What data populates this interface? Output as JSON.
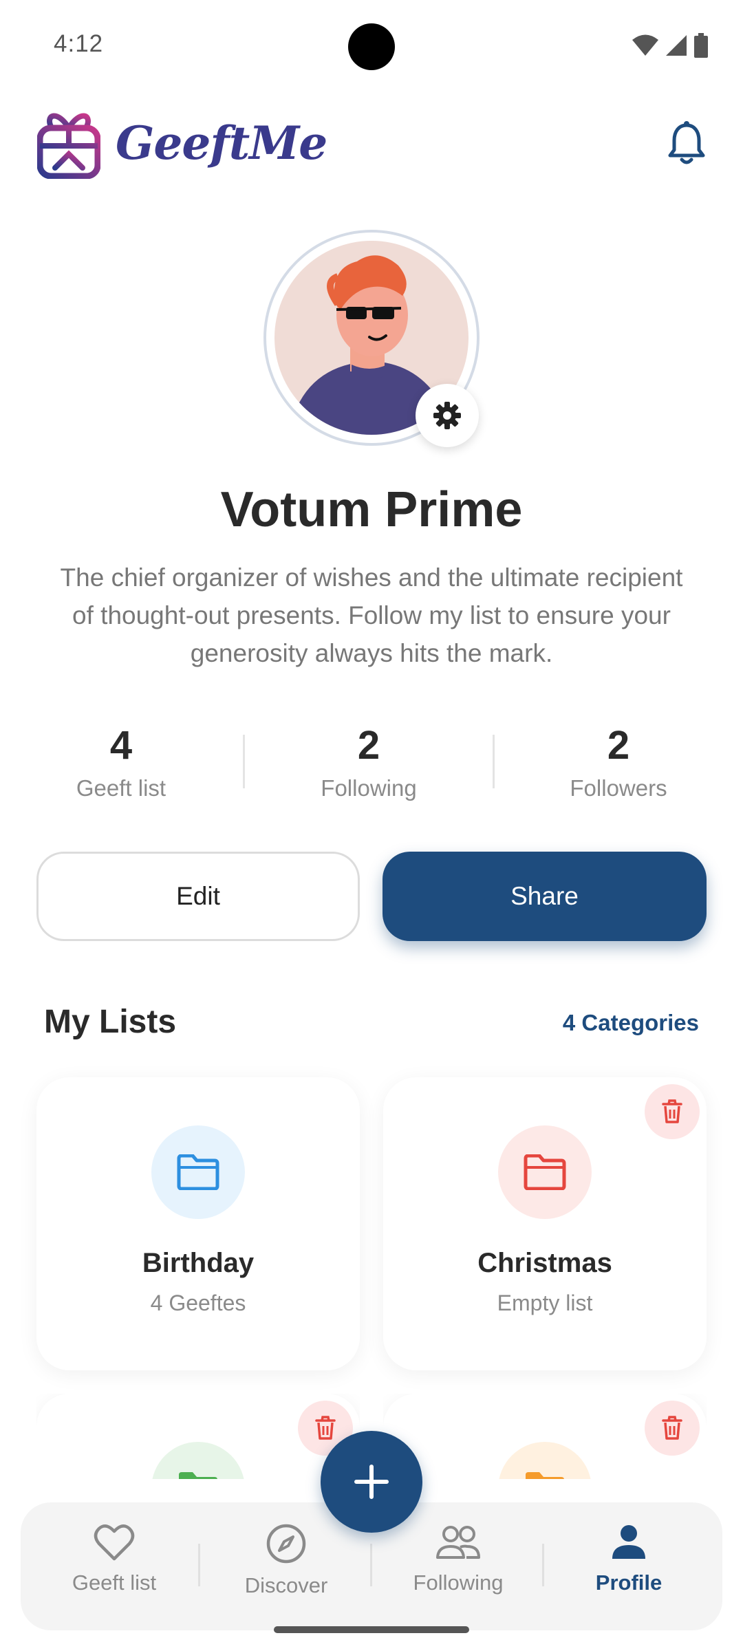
{
  "status_bar": {
    "time": "4:12"
  },
  "header": {
    "app_name": "GeeftMe"
  },
  "profile": {
    "name": "Votum Prime",
    "bio": "The chief organizer of wishes and the ultimate recipient of thought-out presents. Follow my list to ensure your generosity always hits the mark."
  },
  "stats": [
    {
      "value": "4",
      "label": "Geeft list"
    },
    {
      "value": "2",
      "label": "Following"
    },
    {
      "value": "2",
      "label": "Followers"
    }
  ],
  "actions": {
    "edit_label": "Edit",
    "share_label": "Share"
  },
  "lists_section": {
    "title": "My Lists",
    "link": "4 Categories"
  },
  "lists": [
    {
      "title": "Birthday",
      "subtitle": "4 Geeftes",
      "color": "#2d8fe0",
      "bg": "#e6f3fd",
      "deletable": false
    },
    {
      "title": "Christmas",
      "subtitle": "Empty list",
      "color": "#e5463e",
      "bg": "#fde9e7",
      "deletable": true
    },
    {
      "title": "",
      "subtitle": "",
      "color": "#4caf50",
      "bg": "#e7f5e8",
      "deletable": true
    },
    {
      "title": "",
      "subtitle": "",
      "color": "#f59b2b",
      "bg": "#fff1e0",
      "deletable": true
    }
  ],
  "nav": [
    {
      "label": "Geeft list",
      "icon": "heart-icon",
      "active": false
    },
    {
      "label": "Discover",
      "icon": "compass-icon",
      "active": false
    },
    {
      "label": "Following",
      "icon": "people-icon",
      "active": false
    },
    {
      "label": "Profile",
      "icon": "person-icon",
      "active": true
    }
  ],
  "colors": {
    "primary": "#1e4c7e",
    "danger": "#e5463e"
  }
}
